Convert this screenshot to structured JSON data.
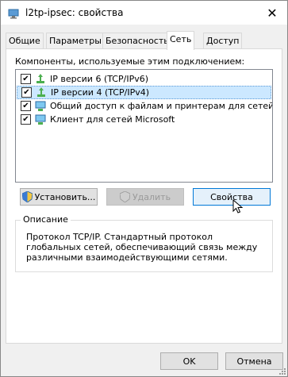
{
  "window": {
    "title": "l2tp-ipsec: свойства",
    "close_glyph": "✕"
  },
  "tabs": [
    {
      "label": "Общие"
    },
    {
      "label": "Параметры"
    },
    {
      "label": "Безопасность"
    },
    {
      "label": "Сеть",
      "active": true
    },
    {
      "label": "Доступ"
    }
  ],
  "network": {
    "components_label": "Компоненты, используемые этим подключением:",
    "items": [
      {
        "label": "IP версии 6 (TCP/IPv6)",
        "checked": true,
        "icon": "network-protocol-icon"
      },
      {
        "label": "IP версии 4 (TCP/IPv4)",
        "checked": true,
        "icon": "network-protocol-icon",
        "selected": true
      },
      {
        "label": "Общий доступ к файлам и принтерам для сетей Micr...",
        "checked": true,
        "icon": "network-service-icon"
      },
      {
        "label": "Клиент для сетей Microsoft",
        "checked": true,
        "icon": "network-client-icon"
      }
    ],
    "install_label": "Установить...",
    "remove_label": "Удалить",
    "properties_label": "Свойства",
    "description_title": "Описание",
    "description_text": "Протокол TCP/IP. Стандартный протокол глобальных сетей, обеспечивающий связь между различными взаимодействующими сетями."
  },
  "footer": {
    "ok_label": "OK",
    "cancel_label": "Отмена"
  },
  "colors": {
    "selection": "#cce8ff",
    "accent": "#0078d7",
    "dialog_bg": "#f0f0f0"
  }
}
